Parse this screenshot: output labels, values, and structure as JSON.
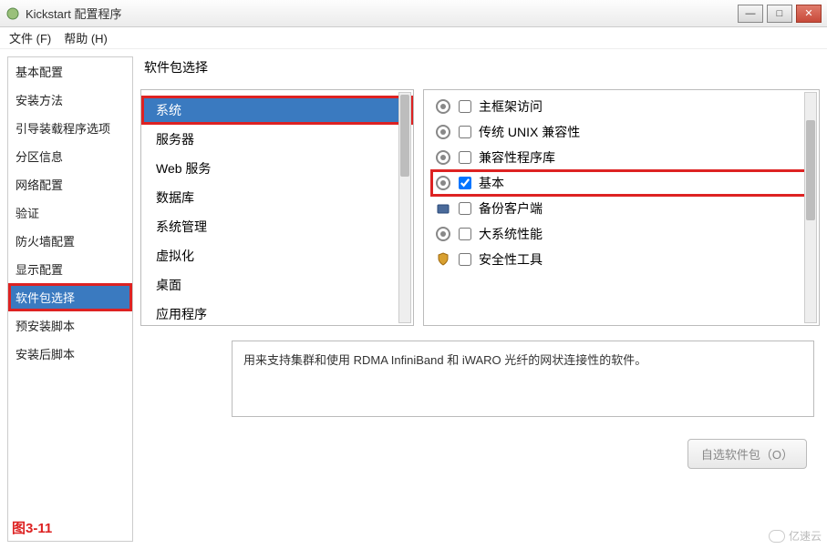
{
  "window": {
    "title": "Kickstart 配置程序"
  },
  "menu": {
    "file": "文件 (F)",
    "help": "帮助 (H)"
  },
  "sidebar": {
    "items": [
      {
        "label": "基本配置"
      },
      {
        "label": "安装方法"
      },
      {
        "label": "引导装载程序选项"
      },
      {
        "label": "分区信息"
      },
      {
        "label": "网络配置"
      },
      {
        "label": "验证"
      },
      {
        "label": "防火墙配置"
      },
      {
        "label": "显示配置"
      },
      {
        "label": "软件包选择",
        "selected": true,
        "highlight": true
      },
      {
        "label": "预安装脚本"
      },
      {
        "label": "安装后脚本"
      }
    ]
  },
  "main": {
    "title": "软件包选择",
    "categories": [
      {
        "label": "系统",
        "selected": true,
        "highlight": true
      },
      {
        "label": "服务器"
      },
      {
        "label": "Web 服务"
      },
      {
        "label": "数据库"
      },
      {
        "label": "系统管理"
      },
      {
        "label": "虚拟化"
      },
      {
        "label": "桌面"
      },
      {
        "label": "应用程序"
      }
    ],
    "packages": [
      {
        "label": "主框架访问",
        "icon": "gear",
        "checked": false
      },
      {
        "label": "传统 UNIX 兼容性",
        "icon": "gear",
        "checked": false
      },
      {
        "label": "兼容性程序库",
        "icon": "gear",
        "checked": false
      },
      {
        "label": "基本",
        "icon": "gear",
        "checked": true,
        "highlight": true
      },
      {
        "label": "备份客户端",
        "icon": "box",
        "checked": false
      },
      {
        "label": "大系统性能",
        "icon": "gear",
        "checked": false
      },
      {
        "label": "安全性工具",
        "icon": "shield",
        "checked": false
      }
    ],
    "description": "用来支持集群和使用 RDMA InfiniBand 和 iWARO 光纤的网状连接性的软件。",
    "button": "自选软件包（O）"
  },
  "figure": "图3-11",
  "watermark": "亿速云"
}
